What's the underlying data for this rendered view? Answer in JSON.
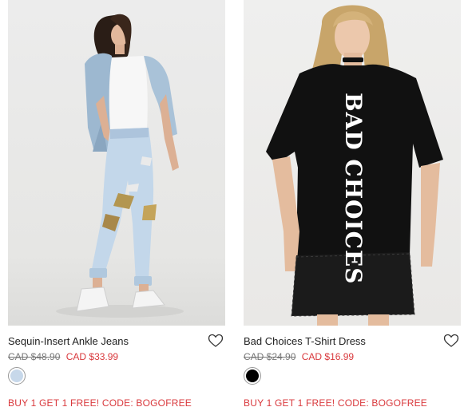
{
  "products": [
    {
      "title": "Sequin-Insert Ankle Jeans",
      "old_price": "CAD $48.90",
      "sale_price": "CAD $33.99",
      "swatch_color": "#c7d8ea",
      "promo": "BUY 1 GET 1 FREE! CODE: BOGOFREE",
      "icon": "heart-outline-icon"
    },
    {
      "title": "Bad Choices T-Shirt Dress",
      "old_price": "CAD $24.90",
      "sale_price": "CAD $16.99",
      "swatch_color": "#000000",
      "promo": "BUY 1 GET 1 FREE! CODE: BOGOFREE",
      "graphic_text": "BAD CHOICES",
      "icon": "heart-outline-icon"
    }
  ],
  "colors": {
    "sale_red": "#d9383c",
    "text_dark": "#222222",
    "text_muted": "#777777"
  }
}
